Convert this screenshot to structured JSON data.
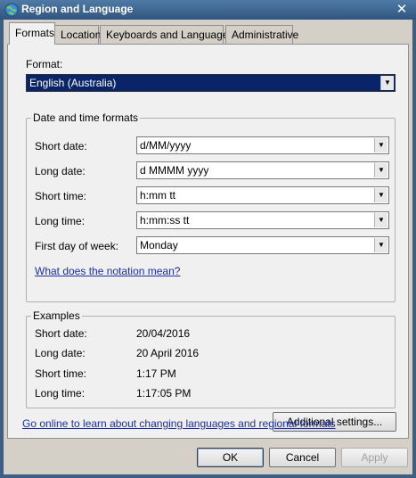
{
  "window": {
    "title": "Region and Language",
    "close_glyph": "✕"
  },
  "tabs": [
    {
      "label": "Formats",
      "active": true
    },
    {
      "label": "Location",
      "active": false
    },
    {
      "label": "Keyboards and Languages",
      "active": false
    },
    {
      "label": "Administrative",
      "active": false
    }
  ],
  "formats": {
    "format_label": "Format:",
    "format_value": "English (Australia)",
    "datetime_group": {
      "title": "Date and time formats",
      "rows": [
        {
          "label": "Short date:",
          "value": "d/MM/yyyy"
        },
        {
          "label": "Long date:",
          "value": "d MMMM yyyy"
        },
        {
          "label": "Short time:",
          "value": "h:mm tt"
        },
        {
          "label": "Long time:",
          "value": "h:mm:ss tt"
        },
        {
          "label": "First day of week:",
          "value": "Monday"
        }
      ],
      "notation_link": "What does the notation mean?"
    },
    "examples_group": {
      "title": "Examples",
      "rows": [
        {
          "label": "Short date:",
          "value": "20/04/2016"
        },
        {
          "label": "Long date:",
          "value": "20 April 2016"
        },
        {
          "label": "Short time:",
          "value": "1:17 PM"
        },
        {
          "label": "Long time:",
          "value": "1:17:05 PM"
        }
      ]
    },
    "additional_settings_label": "Additional settings...",
    "online_link": "Go online to learn about changing languages and regional formats"
  },
  "buttons": {
    "ok": "OK",
    "cancel": "Cancel",
    "apply": "Apply",
    "apply_enabled": false
  },
  "icons": {
    "app": "globe-icon",
    "dropdown": "chevron-down-icon",
    "close": "close-icon"
  },
  "colors": {
    "selection": "#0a246a",
    "link": "#1a2ea6",
    "title_bar": "#3b5f85"
  }
}
